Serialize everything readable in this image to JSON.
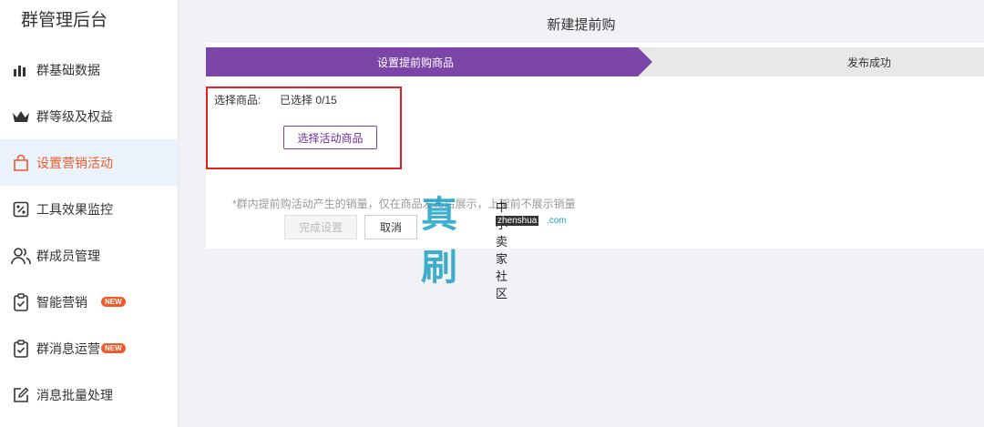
{
  "sidebar": {
    "title": "群管理后台",
    "items": [
      {
        "label": "群基础数据",
        "icon": "bar-chart-icon"
      },
      {
        "label": "群等级及权益",
        "icon": "crown-icon"
      },
      {
        "label": "设置营销活动",
        "icon": "shopping-bag-icon",
        "active": true
      },
      {
        "label": "工具效果监控",
        "icon": "monitor-icon"
      },
      {
        "label": "群成员管理",
        "icon": "users-icon"
      },
      {
        "label": "智能营销",
        "icon": "clipboard-check-icon",
        "badge": "NEW"
      },
      {
        "label": "群消息运营",
        "icon": "clipboard-check-icon",
        "badge": "NEW"
      },
      {
        "label": "消息批量处理",
        "icon": "edit-icon"
      }
    ]
  },
  "page": {
    "title": "新建提前购",
    "steps": [
      {
        "label": "设置提前购商品",
        "state": "active"
      },
      {
        "label": "发布成功",
        "state": "pending"
      }
    ],
    "selection": {
      "label": "选择商品:",
      "value": "已选择  0/15",
      "button": "选择活动商品"
    },
    "note": "*群内提前购活动产生的销量，仅在商品发布后展示，上架前不展示销量",
    "buttons": {
      "done": "完成设置",
      "cancel": "取消"
    }
  },
  "watermark": {
    "big": "真刷",
    "cn": "中小卖家社区",
    "en": "zhenshua",
    "tld": ".com"
  },
  "colors": {
    "accent": "#7b46a8",
    "active_text": "#f05a28",
    "highlight_frame": "#e8201c",
    "badge": "#f05a28"
  }
}
